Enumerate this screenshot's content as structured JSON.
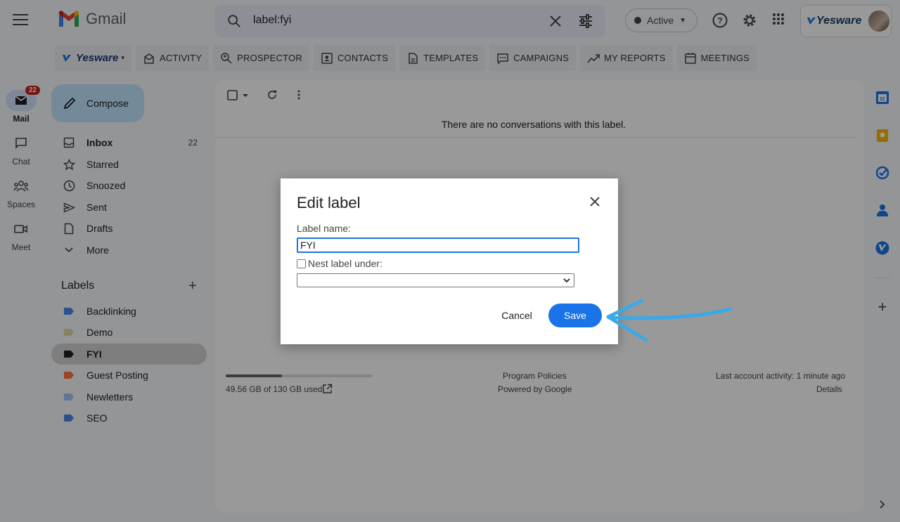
{
  "app": {
    "name": "Gmail"
  },
  "search": {
    "query": "label:fyi"
  },
  "status": {
    "label": "Active",
    "color": "#444746"
  },
  "yesware_box": {
    "brand": "Yesware"
  },
  "toolbar": {
    "brand": "Yesware",
    "items": [
      "ACTIVITY",
      "PROSPECTOR",
      "CONTACTS",
      "TEMPLATES",
      "CAMPAIGNS",
      "MY REPORTS",
      "MEETINGS"
    ]
  },
  "rail": {
    "mail": {
      "label": "Mail",
      "badge": "22"
    },
    "chat": {
      "label": "Chat"
    },
    "spaces": {
      "label": "Spaces"
    },
    "meet": {
      "label": "Meet"
    }
  },
  "compose": {
    "label": "Compose"
  },
  "nav": {
    "inbox": {
      "label": "Inbox",
      "count": "22"
    },
    "starred": {
      "label": "Starred"
    },
    "snoozed": {
      "label": "Snoozed"
    },
    "sent": {
      "label": "Sent"
    },
    "drafts": {
      "label": "Drafts"
    },
    "more": {
      "label": "More"
    }
  },
  "labels": {
    "heading": "Labels",
    "items": [
      {
        "name": "Backlinking",
        "color": "#4a86e8"
      },
      {
        "name": "Demo",
        "color": "#e3d7a3"
      },
      {
        "name": "FYI",
        "color": "#202124"
      },
      {
        "name": "Guest Posting",
        "color": "#ff7537"
      },
      {
        "name": "Newletters",
        "color": "#a4c2f4"
      },
      {
        "name": "SEO",
        "color": "#4a86e8"
      }
    ]
  },
  "main": {
    "empty_message": "There are no conversations with this label.",
    "storage_text": "49.56 GB of 130 GB used",
    "storage_fraction": 0.381,
    "policies": "Program Policies",
    "powered": "Powered by Google",
    "activity": "Last account activity: 1 minute ago",
    "details": "Details"
  },
  "dialog": {
    "title": "Edit label",
    "name_label": "Label name:",
    "name_value": "FYI",
    "nest_label": "Nest label under:",
    "cancel": "Cancel",
    "save": "Save"
  },
  "colors": {
    "accent": "#1a73e8",
    "compose_bg": "#c2e7ff",
    "arrow": "#3aa9e8"
  }
}
